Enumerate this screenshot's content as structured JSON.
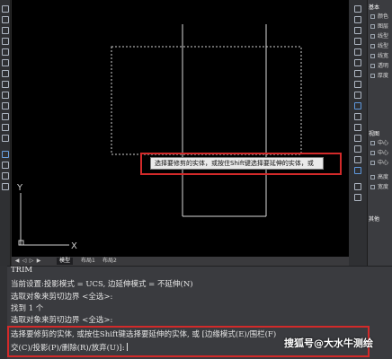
{
  "canvas": {
    "tooltip_text": "选择要修剪的实体，或按住Shift键选择要延伸的实体，或",
    "ucs_x_label": "X",
    "ucs_y_label": "Y"
  },
  "layout_tabs": {
    "tabs": [
      "模型",
      "布局1",
      "布局2"
    ],
    "active": "模型"
  },
  "properties_palette": {
    "section_basic": "基本",
    "basic_rows": [
      "颜色",
      "图层",
      "线型",
      "线型",
      "线宽",
      "透明",
      "厚度"
    ],
    "section_view": "视图",
    "view_rows": [
      "中心",
      "中心",
      "中心",
      "高度",
      "宽度"
    ],
    "section_other": "其他"
  },
  "command_window": {
    "history": [
      "TRIM",
      "当前设置:投影模式 = UCS, 边延伸模式 = 不延伸(N)",
      "选取对象来剪切边界 <全选>:",
      "找到 1 个",
      "选取对象来剪切边界 <全选>:"
    ],
    "prompt_line1": "选择要修剪的实体, 或按住Shift键选择要延伸的实体, 或 [边缘模式(E)/围栏(F)",
    "prompt_line2": "交(C)/投影(P)/删除(R)/放弃(U)]: "
  },
  "watermark": "搜狐号@大水牛测绘",
  "colors": {
    "canvas_bg": "#000000",
    "highlight_red": "#d22a2a",
    "panel_bg": "#3a3b3f"
  }
}
